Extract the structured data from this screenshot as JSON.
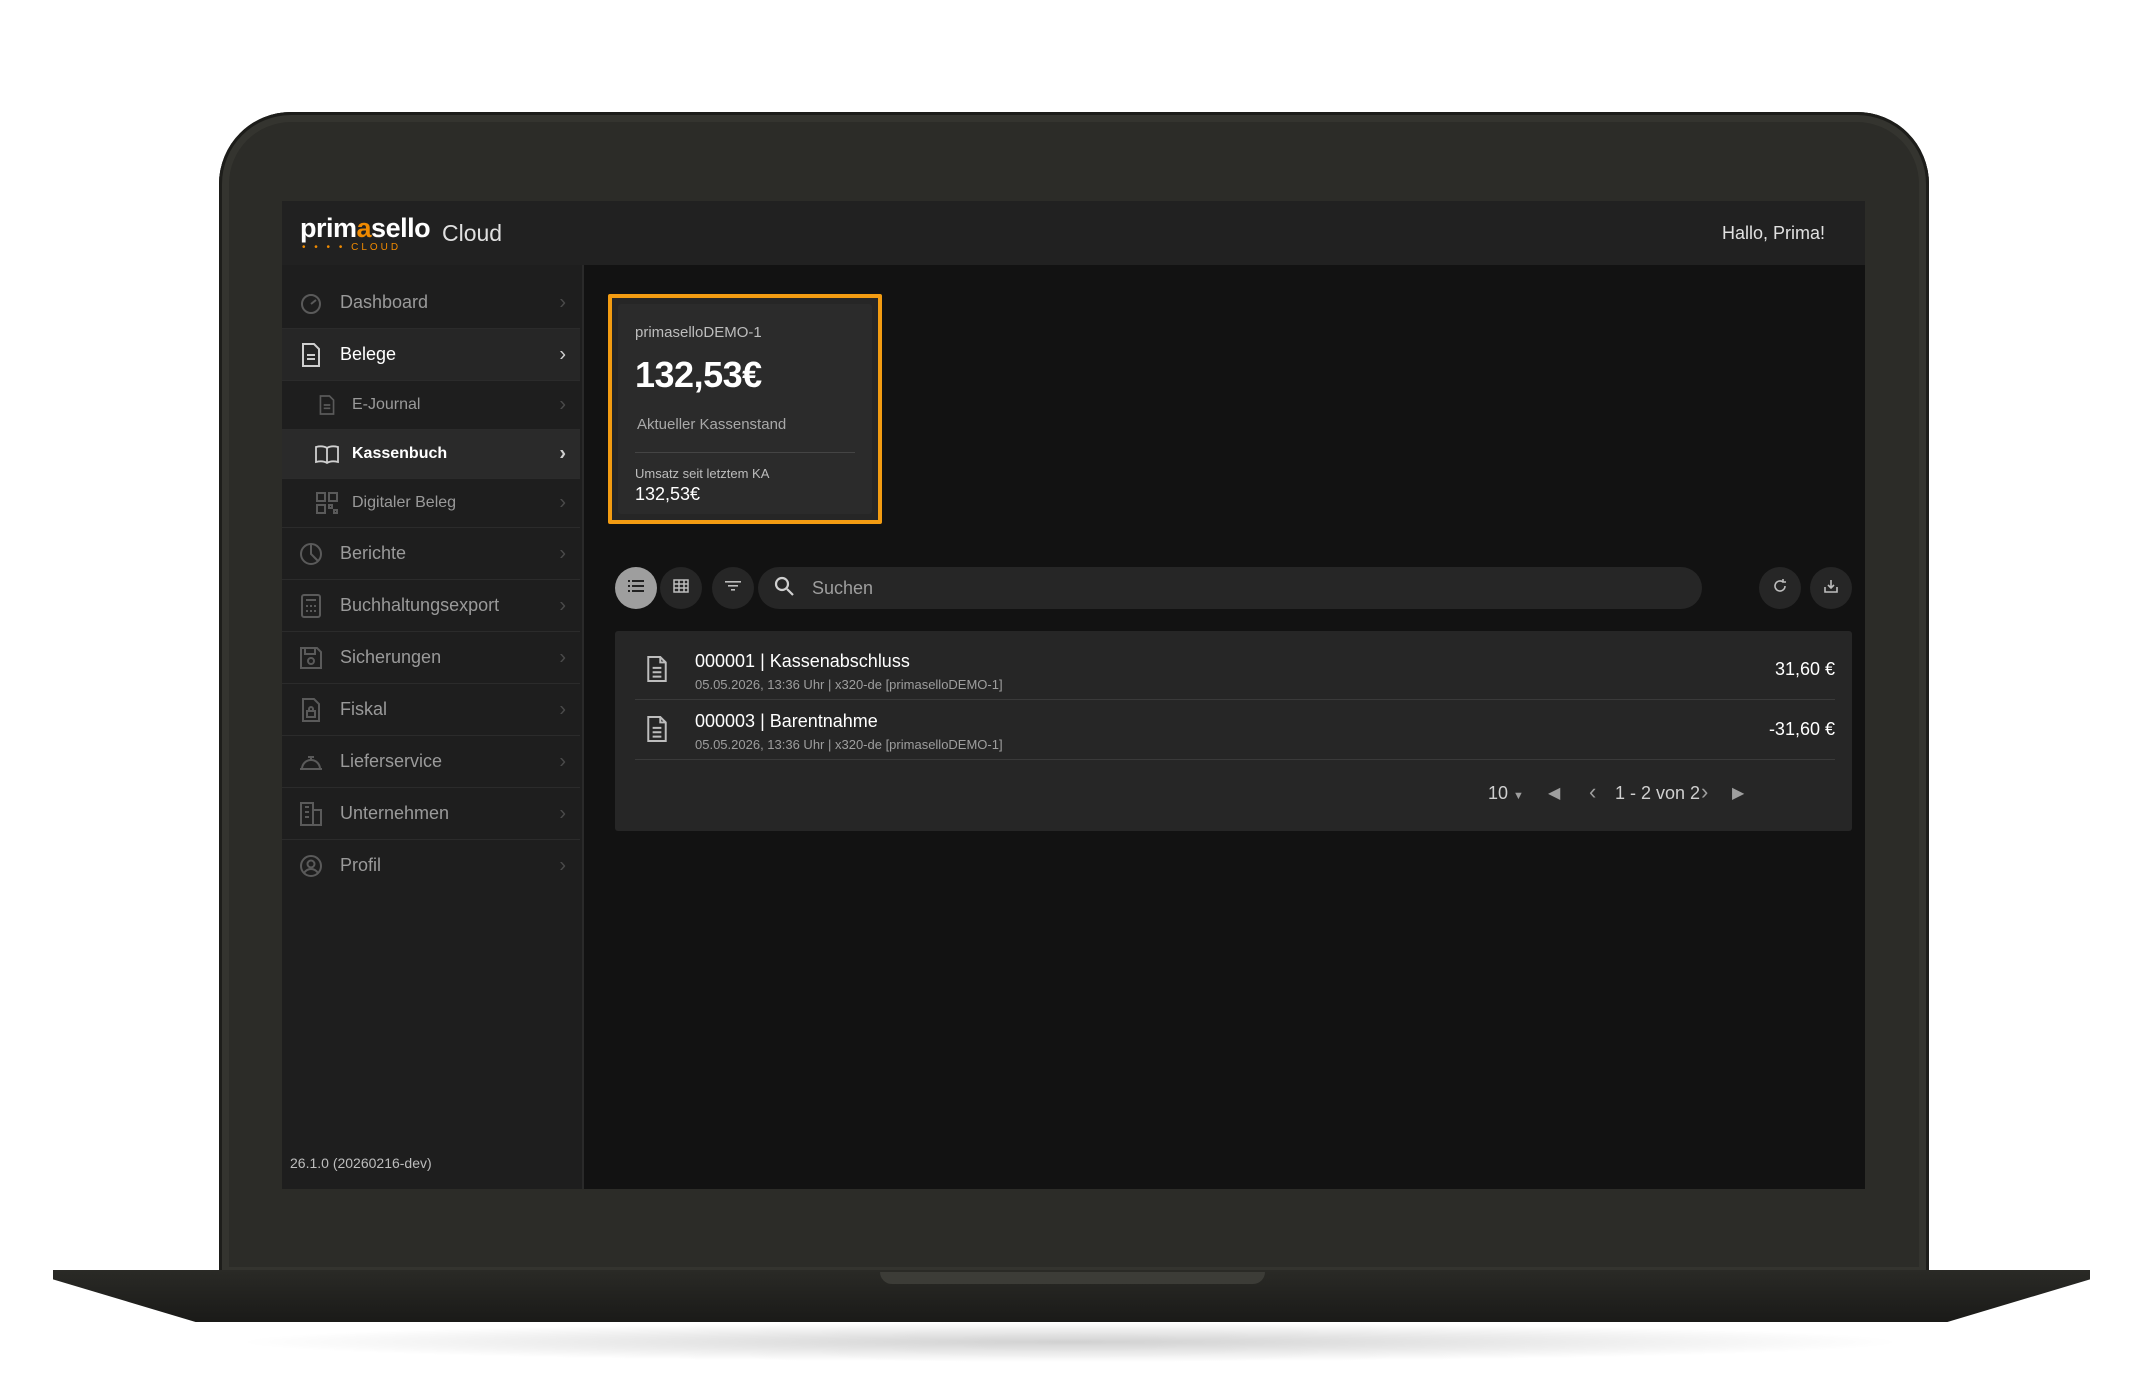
{
  "header": {
    "logo_main_1": "prim",
    "logo_main_a": "a",
    "logo_main_2": "sello",
    "logo_sub": "• • • • CLOUD",
    "app_name": "Cloud",
    "greeting": "Hallo, Prima!"
  },
  "sidebar": {
    "items": [
      {
        "label": "Dashboard",
        "icon": "dashboard-icon"
      },
      {
        "label": "Belege",
        "icon": "document-icon"
      },
      {
        "label": "E-Journal",
        "icon": "document-icon"
      },
      {
        "label": "Kassenbuch",
        "icon": "book-icon"
      },
      {
        "label": "Digitaler Beleg",
        "icon": "qr-code-icon"
      },
      {
        "label": "Berichte",
        "icon": "pie-chart-icon"
      },
      {
        "label": "Buchhaltungsexport",
        "icon": "calculator-icon"
      },
      {
        "label": "Sicherungen",
        "icon": "save-icon"
      },
      {
        "label": "Fiskal",
        "icon": "lock-document-icon"
      },
      {
        "label": "Lieferservice",
        "icon": "delivery-icon"
      },
      {
        "label": "Unternehmen",
        "icon": "building-icon"
      },
      {
        "label": "Profil",
        "icon": "user-icon"
      }
    ],
    "version": "26.1.0 (20260216-dev)"
  },
  "card": {
    "name": "primaselloDEMO-1",
    "total": "132,53€",
    "caption": "Aktueller Kassenstand",
    "sub_label": "Umsatz seit letztem KA",
    "sub_value": "132,53€",
    "highlight_color": "#f39c12"
  },
  "toolbar": {
    "search_placeholder": "Suchen"
  },
  "entries": [
    {
      "title": "000001 | Kassenabschluss",
      "meta": "05.05.2026, 13:36 Uhr | x320-de [primaselloDEMO-1]",
      "amount": "31,60 €"
    },
    {
      "title": "000003 | Barentnahme",
      "meta": "05.05.2026, 13:36 Uhr | x320-de [primaselloDEMO-1]",
      "amount": "-31,60 €"
    }
  ],
  "pager": {
    "page_size": "10",
    "range": "1 - 2 von 2"
  }
}
